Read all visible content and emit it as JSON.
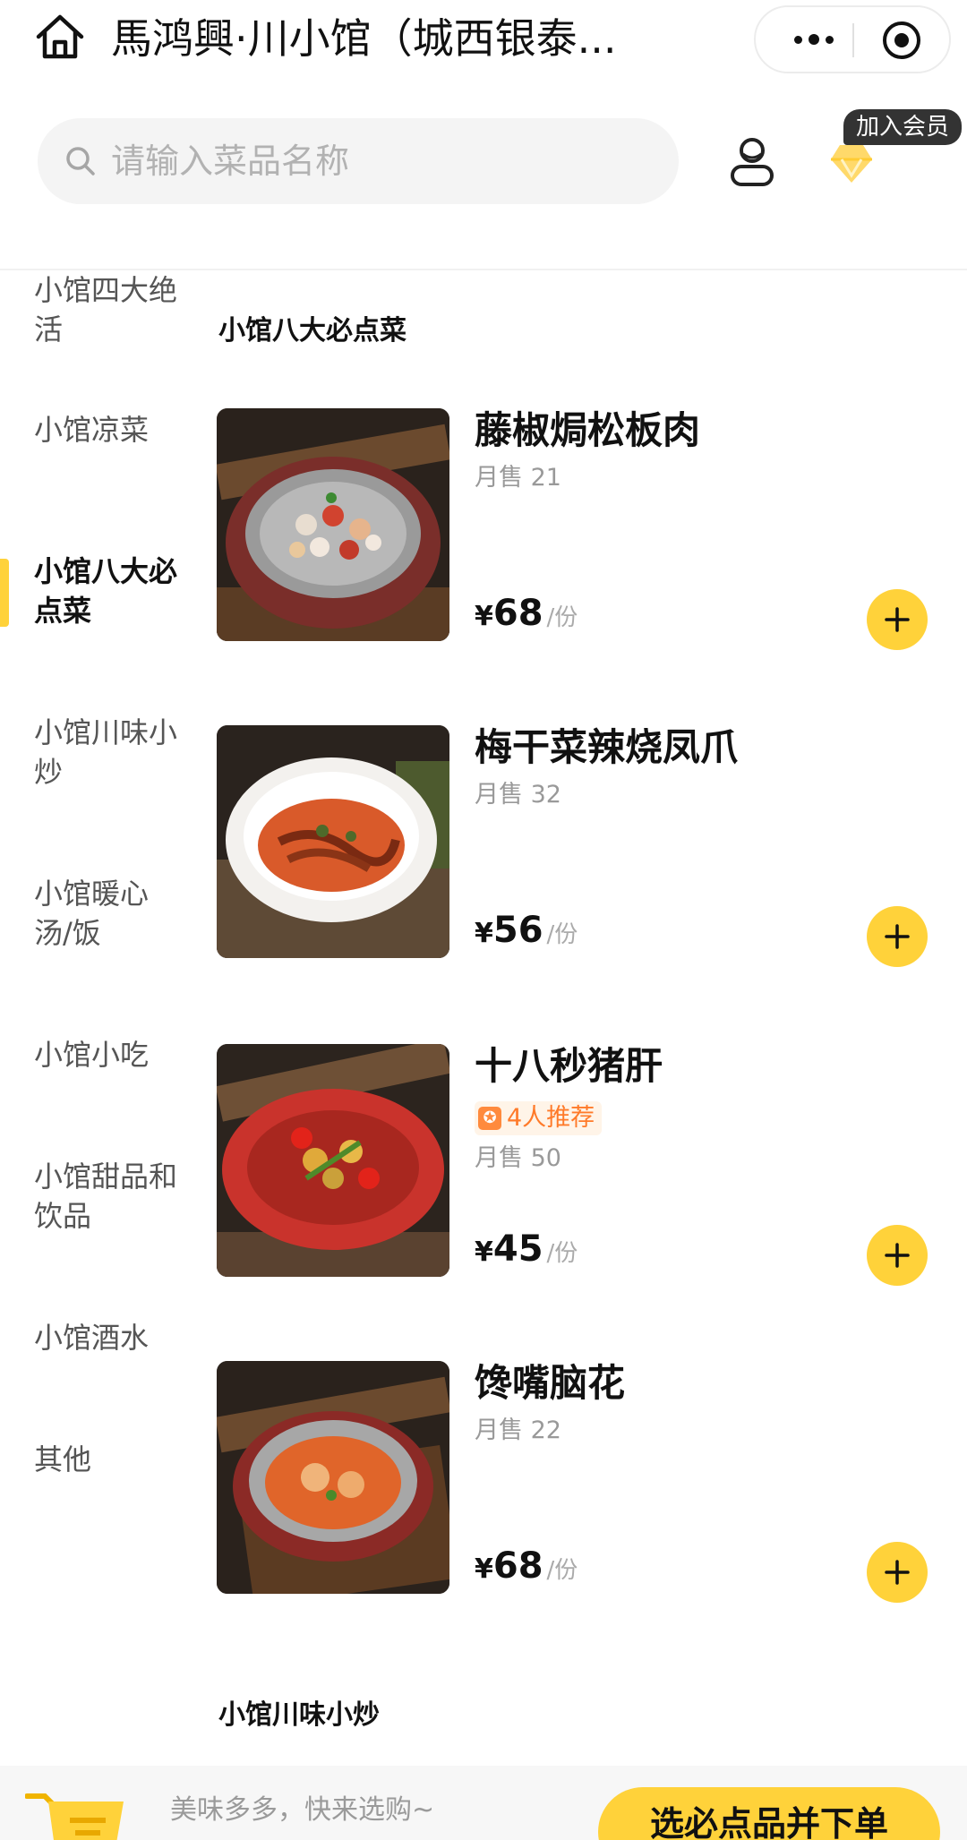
{
  "header": {
    "title": "馬鸿興·川小馆（城西银泰...",
    "more_icon": "more-dots-icon",
    "close_icon": "target-close-icon"
  },
  "search": {
    "placeholder": "请输入菜品名称"
  },
  "member": {
    "badge": "加入会员"
  },
  "sidebar": {
    "categories": [
      {
        "label": "小馆四大绝活"
      },
      {
        "label": "小馆凉菜"
      },
      {
        "label": "小馆八大必点菜",
        "active": true
      },
      {
        "label": "小馆川味小炒"
      },
      {
        "label": "小馆暖心汤/饭"
      },
      {
        "label": "小馆小吃"
      },
      {
        "label": "小馆甜品和饮品"
      },
      {
        "label": "小馆酒水"
      },
      {
        "label": "其他"
      }
    ]
  },
  "content": {
    "section_title": "小馆八大必点菜",
    "next_section_title": "小馆川味小炒",
    "dishes": [
      {
        "name": "藤椒焗松板肉",
        "sales": "月售 21",
        "currency": "¥",
        "price": "68",
        "unit": "/份"
      },
      {
        "name": "梅干菜辣烧凤爪",
        "sales": "月售 32",
        "currency": "¥",
        "price": "56",
        "unit": "/份"
      },
      {
        "name": "十八秒猪肝",
        "recommend": "4人推荐",
        "sales": "月售 50",
        "currency": "¥",
        "price": "45",
        "unit": "/份"
      },
      {
        "name": "馋嘴脑花",
        "sales": "月售 22",
        "currency": "¥",
        "price": "68",
        "unit": "/份"
      }
    ]
  },
  "cart": {
    "hint": "美味多多，快来选购~",
    "checkout_label": "选必点品并下单"
  },
  "colors": {
    "accent": "#ffd23a",
    "recommend": "#ff7a29"
  }
}
